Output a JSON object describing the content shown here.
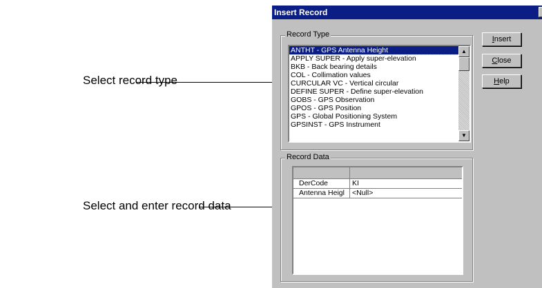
{
  "callouts": {
    "record_type": "Select record type",
    "record_data": "Select and enter record data"
  },
  "dialog": {
    "title": "Insert Record",
    "close_glyph": "×",
    "record_type_group": "Record Type",
    "record_data_group": "Record Data",
    "record_types": [
      "ANTHT - GPS Antenna Height",
      "APPLY SUPER - Apply super-elevation",
      "BKB - Back bearing details",
      "COL - Collimation values",
      "CURCULAR VC - Vertical circular",
      "DEFINE SUPER - Define super-elevation",
      "GOBS - GPS Observation",
      "GPOS - GPS Position",
      "GPS - Global Positioning System",
      "GPSINST - GPS Instrument"
    ],
    "selected_index": 0,
    "buttons": {
      "insert": {
        "mnemonic": "I",
        "rest": "nsert"
      },
      "close": {
        "mnemonic": "C",
        "rest": "lose"
      },
      "help": {
        "mnemonic": "H",
        "rest": "elp"
      }
    },
    "record_data": [
      {
        "field": "DerCode",
        "value": "KI"
      },
      {
        "field": "Antenna Heigl",
        "value": "<Null>"
      }
    ],
    "scroll_up_glyph": "▲",
    "scroll_down_glyph": "▼"
  }
}
